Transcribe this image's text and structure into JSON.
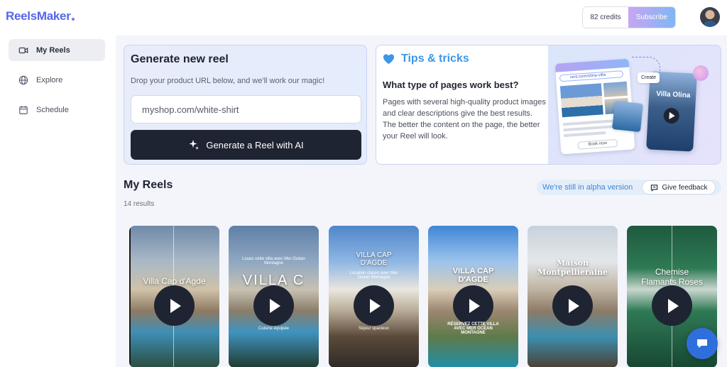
{
  "brand": {
    "name": "ReelsMaker",
    "accent": "#5566e8"
  },
  "header": {
    "credits": "82 credits",
    "subscribe": "Subscribe"
  },
  "sidebar": {
    "items": [
      {
        "label": "My Reels",
        "icon": "video-icon",
        "active": true
      },
      {
        "label": "Explore",
        "icon": "globe-icon",
        "active": false
      },
      {
        "label": "Schedule",
        "icon": "calendar-icon",
        "active": false
      }
    ]
  },
  "generate": {
    "title": "Generate new reel",
    "subtitle": "Drop your product URL below, and we'll work our magic!",
    "input_value": "myshop.com/white-shirt",
    "button": "Generate a Reel with AI"
  },
  "tips": {
    "title": "Tips & tricks",
    "question": "What type of pages work best?",
    "body": "Pages with several high-quality product images and clear descriptions give the best results. The better the content on the page, the better your Reel will look.",
    "visual": {
      "url": "rent.com/olina-villa",
      "create": "Create",
      "phone_title": "Villa Olina",
      "book": "Book now"
    }
  },
  "reels": {
    "title": "My Reels",
    "count": "14 results",
    "alpha": "We're still in alpha version",
    "feedback": "Give feedback",
    "items": [
      {
        "title": "Villa Cap d'Agde",
        "small_top": "",
        "small_bottom": ""
      },
      {
        "title": "VILLA C",
        "small_top": "Louez cette villa avec Mer Océan Montagne",
        "small_bottom": "Cuisine équipée"
      },
      {
        "title": "VILLA CAP D'AGDE",
        "small_top": "Location classe avec Mer Océan Montagne",
        "small_bottom": "Séjour spacieux"
      },
      {
        "title": "VILLA CAP D'AGDE",
        "small_top": "",
        "small_bottom": "RÉSERVEZ CETTE VILLA AVEC MER OCÉAN MONTAGNE"
      },
      {
        "title": "Maison Montpellieraine",
        "small_top": "",
        "small_bottom": ""
      },
      {
        "title": "Chemise Flamants Roses",
        "small_top": "",
        "small_bottom": ""
      }
    ]
  }
}
